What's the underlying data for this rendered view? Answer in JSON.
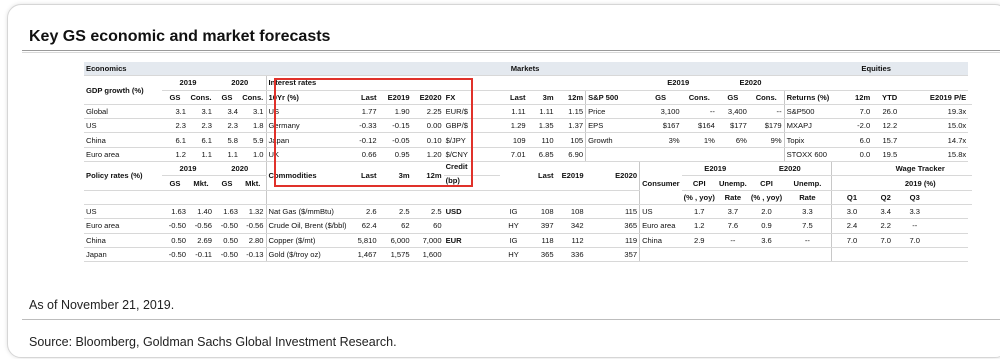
{
  "page": {
    "title": "Key GS economic and market forecasts",
    "as_of": "As of November 21, 2019.",
    "source": "Source: Bloomberg, Goldman Sachs Global Investment Research."
  },
  "headers": {
    "economics": "Economics",
    "markets": "Markets",
    "equities": "Equities"
  },
  "economics": {
    "gdp_label": "GDP growth (%)",
    "policy_label": "Policy rates (%)",
    "y2019": "2019",
    "y2020": "2020",
    "gs": "GS",
    "cons": "Cons.",
    "mkt": "Mkt.",
    "gdp_rows": [
      {
        "name": "Global",
        "v": [
          "3.1",
          "3.1",
          "3.4",
          "3.1"
        ]
      },
      {
        "name": "US",
        "v": [
          "2.3",
          "2.3",
          "2.3",
          "1.8"
        ]
      },
      {
        "name": "China",
        "v": [
          "6.1",
          "6.1",
          "5.8",
          "5.9"
        ]
      },
      {
        "name": "Euro area",
        "v": [
          "1.2",
          "1.1",
          "1.1",
          "1.0"
        ]
      }
    ],
    "policy_rows": [
      {
        "name": "US",
        "v": [
          "1.63",
          "1.40",
          "1.63",
          "1.32"
        ]
      },
      {
        "name": "Euro area",
        "v": [
          "-0.50",
          "-0.56",
          "-0.50",
          "-0.56"
        ]
      },
      {
        "name": "China",
        "v": [
          "0.50",
          "2.69",
          "0.50",
          "2.80"
        ]
      },
      {
        "name": "Japan",
        "v": [
          "-0.50",
          "-0.11",
          "-0.50",
          "-0.13"
        ]
      }
    ]
  },
  "rates": {
    "label1": "Interest rates",
    "label2": "10Yr (%)",
    "cols": [
      "Last",
      "E2019",
      "E2020"
    ],
    "rows": [
      {
        "name": "US",
        "v": [
          "1.77",
          "1.90",
          "2.25"
        ]
      },
      {
        "name": "Germany",
        "v": [
          "-0.33",
          "-0.15",
          "0.00"
        ]
      },
      {
        "name": "Japan",
        "v": [
          "-0.12",
          "-0.05",
          "0.10"
        ]
      },
      {
        "name": "UK",
        "v": [
          "0.66",
          "0.95",
          "1.20"
        ]
      }
    ]
  },
  "commodities": {
    "label": "Commodities",
    "cols": [
      "Last",
      "3m",
      "12m"
    ],
    "rows": [
      {
        "name": "Nat Gas ($/mmBtu)",
        "v": [
          "2.6",
          "2.5",
          "2.5"
        ]
      },
      {
        "name": "Crude Oil, Brent ($/bbl)",
        "v": [
          "62.4",
          "62",
          "60"
        ]
      },
      {
        "name": "Copper ($/mt)",
        "v": [
          "5,810",
          "6,000",
          "7,000"
        ]
      },
      {
        "name": "Gold ($/troy oz)",
        "v": [
          "1,467",
          "1,575",
          "1,600"
        ]
      }
    ]
  },
  "fx": {
    "label": "FX",
    "cols": [
      "Last",
      "3m",
      "12m"
    ],
    "rows": [
      {
        "name": "EUR/$",
        "v": [
          "1.11",
          "1.11",
          "1.15"
        ]
      },
      {
        "name": "GBP/$",
        "v": [
          "1.29",
          "1.35",
          "1.37"
        ]
      },
      {
        "name": "$/JPY",
        "v": [
          "109",
          "110",
          "105"
        ]
      },
      {
        "name": "$/CNY",
        "v": [
          "7.01",
          "6.85",
          "6.90"
        ]
      }
    ]
  },
  "credit": {
    "label1": "Credit",
    "label2": "(bp)",
    "cols": [
      "Last",
      "E2019",
      "E2020"
    ],
    "rows": [
      {
        "cur": "USD",
        "grade": "IG",
        "v": [
          "108",
          "108",
          "115"
        ]
      },
      {
        "cur": "",
        "grade": "HY",
        "v": [
          "397",
          "342",
          "365"
        ]
      },
      {
        "cur": "EUR",
        "grade": "IG",
        "v": [
          "118",
          "112",
          "119"
        ]
      },
      {
        "cur": "",
        "grade": "HY",
        "v": [
          "365",
          "336",
          "357"
        ]
      }
    ]
  },
  "sp500": {
    "label": "S&P 500",
    "e2019": "E2019",
    "e2020": "E2020",
    "gs": "GS",
    "cons": "Cons.",
    "rows": [
      {
        "name": "Price",
        "v": [
          "3,100",
          "--",
          "3,400",
          "--"
        ]
      },
      {
        "name": "EPS",
        "v": [
          "$167",
          "$164",
          "$177",
          "$179"
        ]
      },
      {
        "name": "Growth",
        "v": [
          "3%",
          "1%",
          "6%",
          "9%"
        ]
      }
    ]
  },
  "consumer": {
    "label": "Consumer",
    "e2019": "E2019",
    "e2020": "E2020",
    "cpi": "CPI",
    "cpi2": "(% , yoy)",
    "unemp": "Unemp.",
    "rate": "Rate",
    "rows": [
      {
        "name": "US",
        "v": [
          "1.7",
          "3.7",
          "2.0",
          "3.3"
        ]
      },
      {
        "name": "Euro area",
        "v": [
          "1.2",
          "7.6",
          "0.9",
          "7.5"
        ]
      },
      {
        "name": "China",
        "v": [
          "2.9",
          "--",
          "3.6",
          "--"
        ]
      }
    ]
  },
  "equities": {
    "returns_label": "Returns (%)",
    "cols": [
      "12m",
      "YTD",
      "E2019 P/E"
    ],
    "rows": [
      {
        "name": "S&P500",
        "v": [
          "7.0",
          "26.0",
          "19.3x"
        ]
      },
      {
        "name": "MXAPJ",
        "v": [
          "-2.0",
          "12.2",
          "15.0x"
        ]
      },
      {
        "name": "Topix",
        "v": [
          "6.0",
          "15.7",
          "14.7x"
        ]
      },
      {
        "name": "STOXX 600",
        "v": [
          "0.0",
          "19.5",
          "15.8x"
        ]
      }
    ]
  },
  "wage": {
    "label1": "Wage Tracker",
    "label2": "2019 (%)",
    "cols": [
      "Q1",
      "Q2",
      "Q3"
    ],
    "rows": [
      {
        "v": [
          "3.0",
          "3.4",
          "3.3"
        ]
      },
      {
        "v": [
          "2.4",
          "2.2",
          "--"
        ]
      },
      {
        "v": [
          "7.0",
          "7.0",
          "7.0"
        ]
      }
    ]
  }
}
